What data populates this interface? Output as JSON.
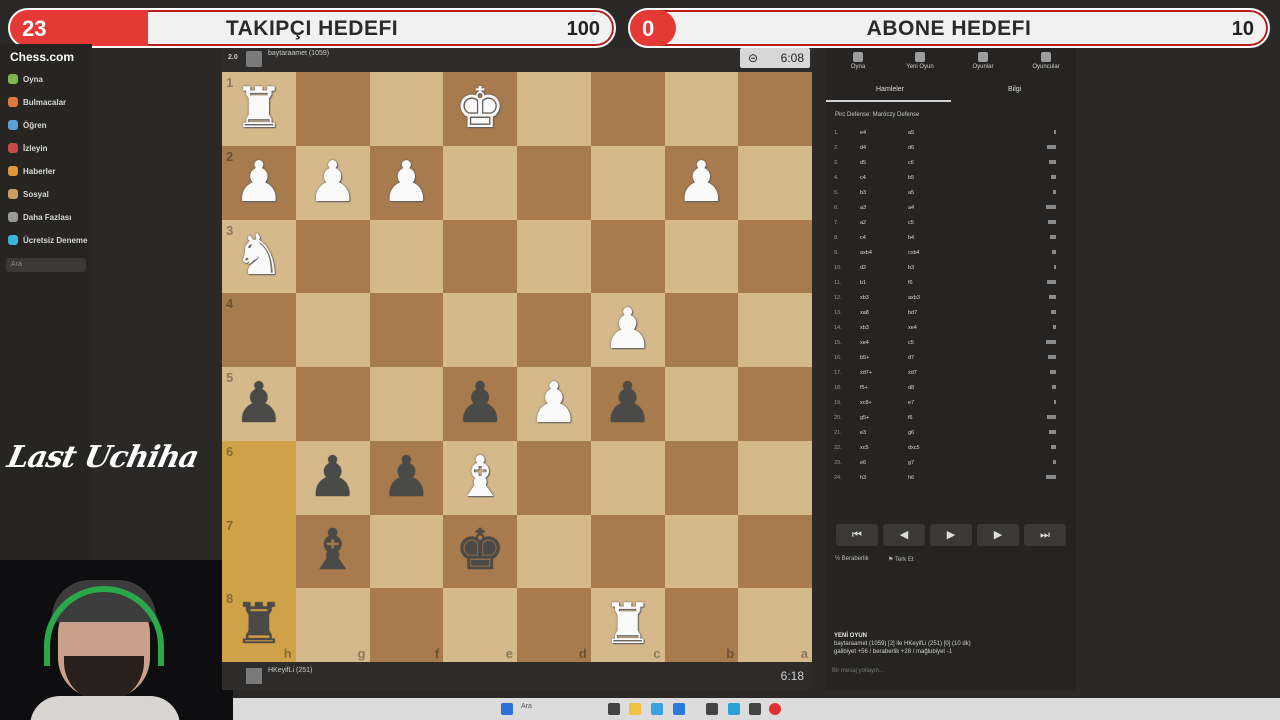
{
  "overlay": {
    "followers": {
      "current": "23",
      "title": "TAKIPÇI HEDEFI",
      "target": "100",
      "progress_fraction": 0.23
    },
    "subscribers": {
      "current": "0",
      "title": "ABONE HEDEFI",
      "target": "10",
      "progress_fraction": 0.0
    },
    "watermark": "Last Uchiha"
  },
  "sidebar": {
    "logo": "Chess.com",
    "items": [
      {
        "label": "Oyna",
        "color": "#81b64c"
      },
      {
        "label": "Bulmacalar",
        "color": "#e07a3c"
      },
      {
        "label": "Öğren",
        "color": "#5aa0d8"
      },
      {
        "label": "İzleyin",
        "color": "#c94a4a"
      },
      {
        "label": "Haberler",
        "color": "#e0963c"
      },
      {
        "label": "Sosyal",
        "color": "#c9a060"
      },
      {
        "label": "Daha Fazlası",
        "color": "#9a9a9a"
      },
      {
        "label": "Ücretsiz Deneme",
        "color": "#3ab6d8"
      }
    ],
    "search_placeholder": "Ara"
  },
  "top_player": {
    "rating_badge": "2.0",
    "name": "baytaraamet (1059)",
    "clock": "6:08"
  },
  "bottom_player": {
    "name": "HKeyifLi (251)",
    "clock": "6:18"
  },
  "board": {
    "files_bottom": [
      "h",
      "g",
      "f",
      "e",
      "d",
      "c",
      "b",
      "a"
    ],
    "ranks": [
      "1",
      "2",
      "3",
      "4",
      "5",
      "6",
      "7",
      "8"
    ],
    "highlighted": [
      "5-0",
      "6-0",
      "7-0"
    ],
    "pieces": [
      {
        "sq": "0-0",
        "p": "♜",
        "c": "w"
      },
      {
        "sq": "0-3",
        "p": "♚",
        "c": "w"
      },
      {
        "sq": "1-0",
        "p": "♟",
        "c": "w"
      },
      {
        "sq": "1-1",
        "p": "♟",
        "c": "w"
      },
      {
        "sq": "1-2",
        "p": "♟",
        "c": "w"
      },
      {
        "sq": "1-6",
        "p": "♟",
        "c": "w"
      },
      {
        "sq": "2-0",
        "p": "♞",
        "c": "w"
      },
      {
        "sq": "3-5",
        "p": "♟",
        "c": "w"
      },
      {
        "sq": "4-0",
        "p": "♟",
        "c": "b"
      },
      {
        "sq": "4-3",
        "p": "♟",
        "c": "b"
      },
      {
        "sq": "4-4",
        "p": "♟",
        "c": "w"
      },
      {
        "sq": "4-5",
        "p": "♟",
        "c": "b"
      },
      {
        "sq": "5-1",
        "p": "♟",
        "c": "b"
      },
      {
        "sq": "5-2",
        "p": "♟",
        "c": "b"
      },
      {
        "sq": "5-3",
        "p": "♝",
        "c": "w"
      },
      {
        "sq": "6-1",
        "p": "♝",
        "c": "b"
      },
      {
        "sq": "6-3",
        "p": "♚",
        "c": "b"
      },
      {
        "sq": "7-0",
        "p": "♜",
        "c": "b"
      },
      {
        "sq": "7-5",
        "p": "♜",
        "c": "w"
      }
    ]
  },
  "panel": {
    "tabs": [
      "Oyna",
      "Yeni Oyun",
      "Oyunlar",
      "Oyuncular"
    ],
    "subtabs": [
      "Hamleler",
      "Bilgi"
    ],
    "opening": "Pirc Defense: Maróczy Defense",
    "moves": [
      [
        "1.",
        "e4",
        "a5"
      ],
      [
        "2.",
        "d4",
        "d6"
      ],
      [
        "3.",
        "d5",
        "c6"
      ],
      [
        "4.",
        "c4",
        "b5"
      ],
      [
        "5.",
        "b3",
        "a5"
      ],
      [
        "6.",
        "a3",
        "a4"
      ],
      [
        "7.",
        "a2",
        "c5"
      ],
      [
        "8.",
        "c4",
        "b4"
      ],
      [
        "9.",
        "axb4",
        "cxb4"
      ],
      [
        "10.",
        "d2",
        "b3"
      ],
      [
        "11.",
        "b1",
        "f6"
      ],
      [
        "12.",
        "xb3",
        "axb3"
      ],
      [
        "13.",
        "xa8",
        "bd7"
      ],
      [
        "14.",
        "xb3",
        "xe4"
      ],
      [
        "15.",
        "xe4",
        "c5"
      ],
      [
        "16.",
        "b5+",
        "d7"
      ],
      [
        "17.",
        "xd7+",
        "xd7"
      ],
      [
        "18.",
        "f5+",
        "d8"
      ],
      [
        "19.",
        "xc8+",
        "e7"
      ],
      [
        "20.",
        "g5+",
        "f6"
      ],
      [
        "21.",
        "e3",
        "g6"
      ],
      [
        "22.",
        "xc5",
        "dxc5"
      ],
      [
        "23.",
        "e6",
        "g7"
      ],
      [
        "24.",
        "h3",
        "h6"
      ]
    ],
    "controls": [
      "⏮",
      "◀",
      "▶",
      "▶",
      "⏭"
    ],
    "draw_label": "Beraberlik",
    "resign_label": "Terk Et",
    "new_game_title": "YENİ OYUN",
    "new_game_line1": "baytaraamet (1059) [2] ile HKeyifLi (251) [0] (10 dk)",
    "new_game_line2": "galibiyet +56 / beraberlik +28 / mağlubiyet -1",
    "chat_placeholder": "Bir mesaj yollayın..."
  },
  "taskbar": {
    "search": "Ara"
  }
}
